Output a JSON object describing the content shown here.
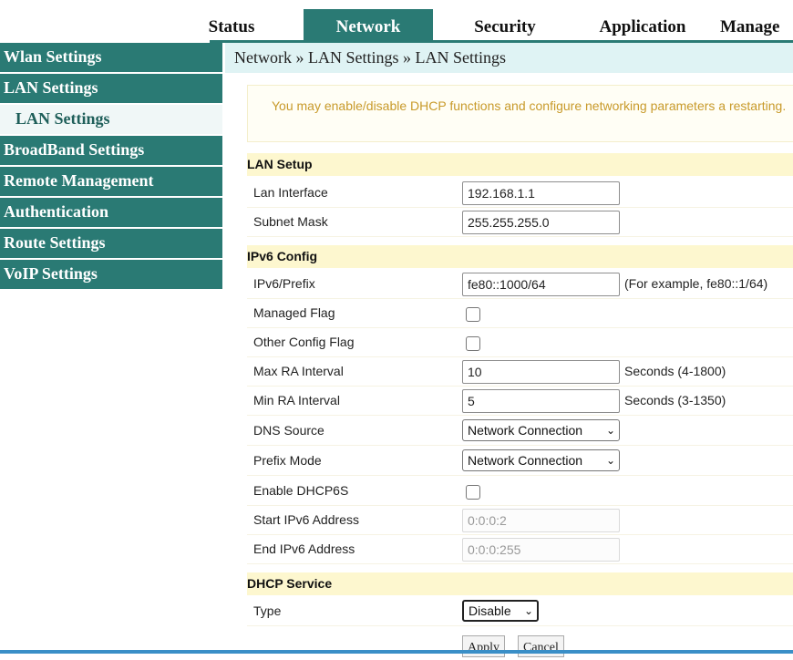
{
  "top_nav": {
    "tabs": [
      {
        "label": "Status"
      },
      {
        "label": "Network"
      },
      {
        "label": "Security"
      },
      {
        "label": "Application"
      },
      {
        "label": "Manage"
      }
    ],
    "active_tab": "Network"
  },
  "left_menu": {
    "items": [
      {
        "label": "Wlan Settings"
      },
      {
        "label": "LAN Settings"
      },
      {
        "label": "LAN Settings"
      },
      {
        "label": "BroadBand Settings"
      },
      {
        "label": "Remote Management"
      },
      {
        "label": "Authentication"
      },
      {
        "label": "Route Settings"
      },
      {
        "label": "VoIP Settings"
      }
    ]
  },
  "breadcrumb": "Network » LAN Settings » LAN Settings",
  "info_text": "You may enable/disable DHCP functions and configure networking parameters a restarting.",
  "lan_setup": {
    "title": "LAN Setup",
    "lan_interface_label": "Lan Interface",
    "lan_interface_value": "192.168.1.1",
    "subnet_mask_label": "Subnet Mask",
    "subnet_mask_value": "255.255.255.0"
  },
  "ipv6": {
    "title": "IPv6 Config",
    "prefix_label": "IPv6/Prefix",
    "prefix_value": "fe80::1000/64",
    "prefix_hint": "(For example, fe80::1/64)",
    "managed_flag_label": "Managed Flag",
    "managed_flag_checked": false,
    "other_config_flag_label": "Other Config Flag",
    "other_config_flag_checked": false,
    "max_ra_label": "Max RA Interval",
    "max_ra_value": "10",
    "max_ra_hint": "Seconds (4-1800)",
    "min_ra_label": "Min RA Interval",
    "min_ra_value": "5",
    "min_ra_hint": "Seconds (3-1350)",
    "dns_source_label": "DNS Source",
    "dns_source_value": "Network Connection",
    "prefix_mode_label": "Prefix Mode",
    "prefix_mode_value": "Network Connection",
    "enable_dhcp6s_label": "Enable DHCP6S",
    "enable_dhcp6s_checked": false,
    "start_addr_label": "Start IPv6 Address",
    "start_addr_value": "0:0:0:2",
    "end_addr_label": "End IPv6 Address",
    "end_addr_value": "0:0:0:255"
  },
  "dhcp": {
    "title": "DHCP Service",
    "type_label": "Type",
    "type_value": "Disable"
  },
  "buttons": {
    "apply": "Apply",
    "cancel": "Cancel"
  },
  "colors": {
    "accent": "#2a7a74",
    "section_bg": "#fdf7cf",
    "info_text": "#c89a2a"
  }
}
